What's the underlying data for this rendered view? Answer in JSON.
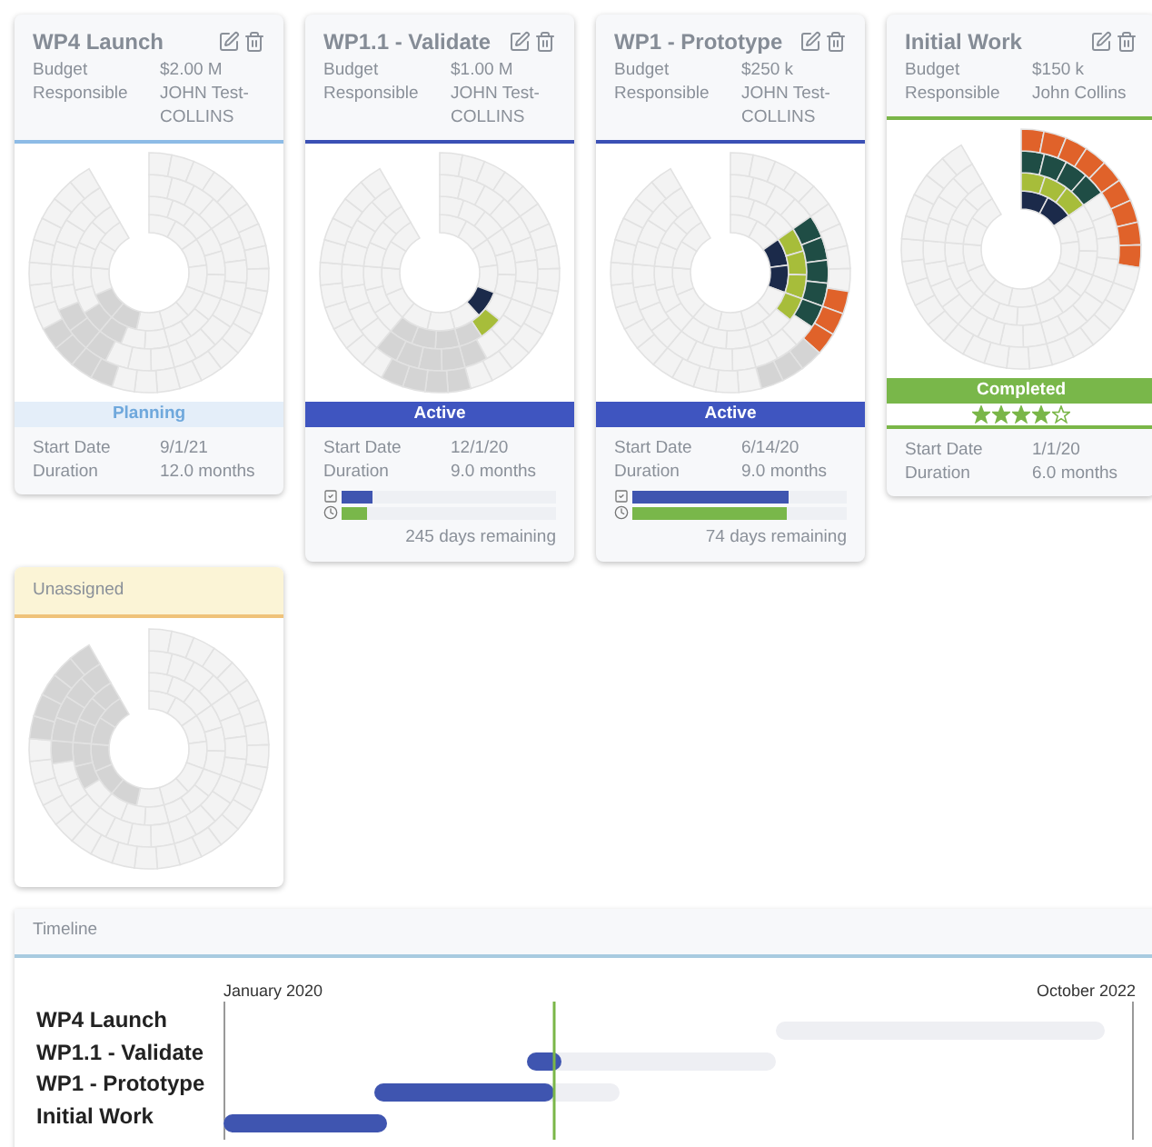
{
  "cards": [
    {
      "title": "WP4 Launch",
      "budget_label": "Budget",
      "budget": "$2.00 M",
      "responsible_label": "Responsible",
      "responsible": "JOHN Test-COLLINS",
      "status": {
        "kind": "planning",
        "label": "Planning"
      },
      "start_label": "Start Date",
      "start": "9/1/21",
      "duration_label": "Duration",
      "duration": "12.0 months"
    },
    {
      "title": "WP1.1 - Validate",
      "budget_label": "Budget",
      "budget": "$1.00 M",
      "responsible_label": "Responsible",
      "responsible": "JOHN Test-COLLINS",
      "status": {
        "kind": "active",
        "label": "Active"
      },
      "start_label": "Start Date",
      "start": "12/1/20",
      "duration_label": "Duration",
      "duration": "9.0 months",
      "progress": {
        "tasks": {
          "level": 0.14
        },
        "time": {
          "level": 0.12
        },
        "remaining": "245 days remaining"
      }
    },
    {
      "title": "WP1 - Prototype",
      "budget_label": "Budget",
      "budget": "$250 k",
      "responsible_label": "Responsible",
      "responsible": "JOHN Test-COLLINS",
      "status": {
        "kind": "active",
        "label": "Active"
      },
      "start_label": "Start Date",
      "start": "6/14/20",
      "duration_label": "Duration",
      "duration": "9.0 months",
      "progress": {
        "tasks": {
          "level": 0.73
        },
        "time": {
          "level": 0.72
        },
        "remaining": "74 days remaining"
      }
    },
    {
      "title": "Initial Work",
      "budget_label": "Budget",
      "budget": "$150 k",
      "responsible_label": "Responsible",
      "responsible": "John Collins",
      "status": {
        "kind": "completed",
        "label": "Completed"
      },
      "stars": 4,
      "start_label": "Start Date",
      "start": "1/1/20",
      "duration_label": "Duration",
      "duration": "6.0 months"
    }
  ],
  "unassigned": {
    "title": "Unassigned"
  },
  "timeline": {
    "title": "Timeline",
    "start_label": "January 2020",
    "end_label": "October 2022",
    "rows": [
      {
        "label": "WP4 Launch"
      },
      {
        "label": "WP1.1 - Validate"
      },
      {
        "label": "WP1 - Prototype"
      },
      {
        "label": "Initial Work"
      }
    ]
  }
}
